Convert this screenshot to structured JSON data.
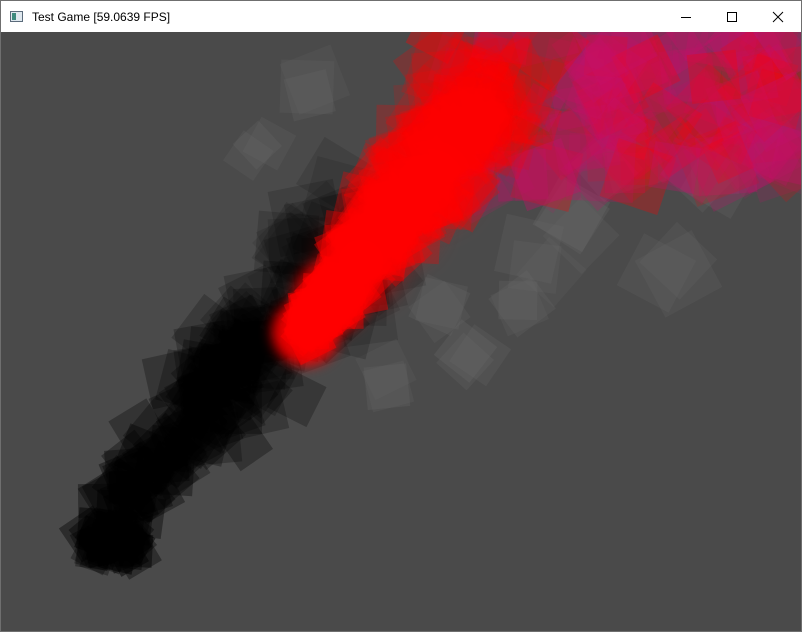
{
  "window": {
    "title": "Test Game [59.0639 FPS]",
    "icon": "app-window-icon",
    "controls": {
      "minimize": "minimize-icon",
      "maximize": "maximize-icon",
      "close": "close-icon"
    }
  },
  "scene": {
    "background_color": "#4a4a4a",
    "particle_colors": {
      "smoke": "#000000",
      "fire": "#ff0000",
      "magenta": "#c4106a",
      "haze": "#6a6a6a"
    }
  }
}
